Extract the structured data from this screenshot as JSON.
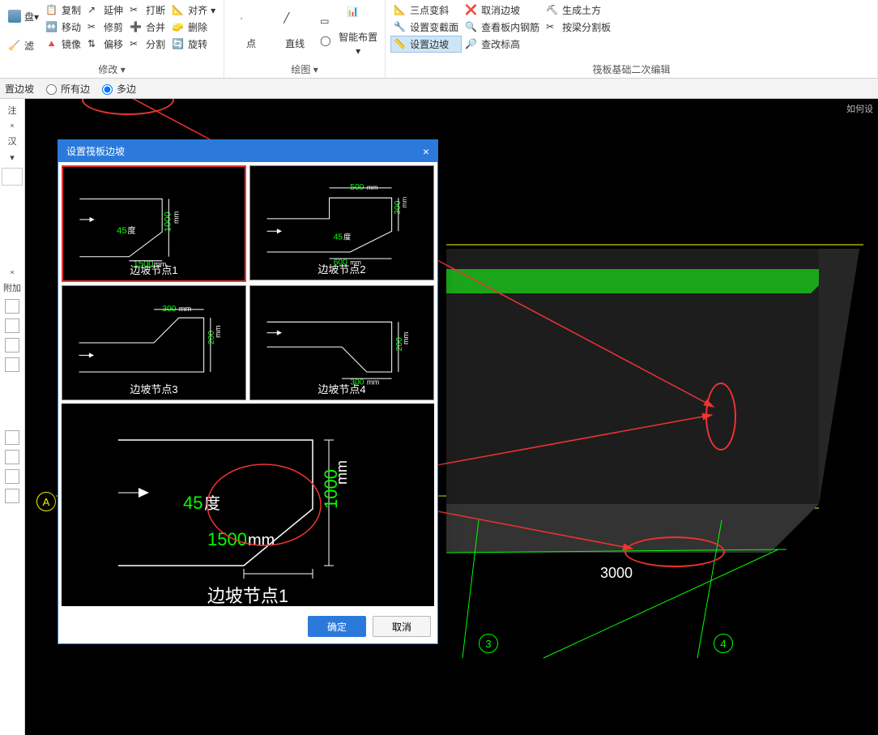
{
  "ribbon": {
    "modify": {
      "items": [
        "复制",
        "延伸",
        "打断",
        "对齐",
        "移动",
        "修剪",
        "合并",
        "删除",
        "镜像",
        "偏移",
        "分割",
        "旋转"
      ],
      "label": "修改",
      "dropdown": "▾"
    },
    "draw": {
      "point": "点",
      "line": "直线",
      "smart": "智能布置",
      "label": "绘图",
      "dropdown": "▾"
    },
    "raft": {
      "items": [
        "三点变斜",
        "取消边坡",
        "生成土方",
        "设置变截面",
        "查看板内钢筋",
        "按梁分割板",
        "设置边坡",
        "查改标高"
      ],
      "label": "筏板基础二次编辑"
    }
  },
  "optbar": {
    "cmd": "置边坡",
    "opt1": "所有边",
    "opt2": "多边"
  },
  "side": {
    "tab1": "注",
    "tab2": "汉",
    "tab3": "附加"
  },
  "dialog": {
    "title": "设置筏板边坡",
    "thumbs": [
      "边坡节点1",
      "边坡节点2",
      "边坡节点3",
      "边坡节点4"
    ],
    "t1": {
      "angle": "45",
      "angle_unit": "度",
      "w": "1500",
      "w_unit": "mm",
      "h": "1000",
      "h_unit": "mm"
    },
    "t2": {
      "top": "500",
      "top_unit": "mm",
      "right": "300",
      "right_unit": "mm",
      "bottom": "600",
      "bottom_unit": "mm",
      "angle": "45",
      "angle_unit": "度"
    },
    "t3": {
      "top": "300",
      "top_unit": " mm",
      "right": "200",
      "right_unit": " mm"
    },
    "t4": {
      "bottom": "300",
      "bottom_unit": " mm",
      "right": "200",
      "right_unit": " mm"
    },
    "preview": {
      "angle": "45",
      "angle_unit": "度",
      "w": "1500",
      "w_unit": " mm",
      "h": "1000",
      "h_unit": " mm",
      "label": "边坡节点1"
    },
    "ok": "确定",
    "cancel": "取消"
  },
  "model": {
    "dim": "3000",
    "axis_l": "3",
    "axis_r": "4",
    "axis_v": "A"
  },
  "hint": "如何设"
}
